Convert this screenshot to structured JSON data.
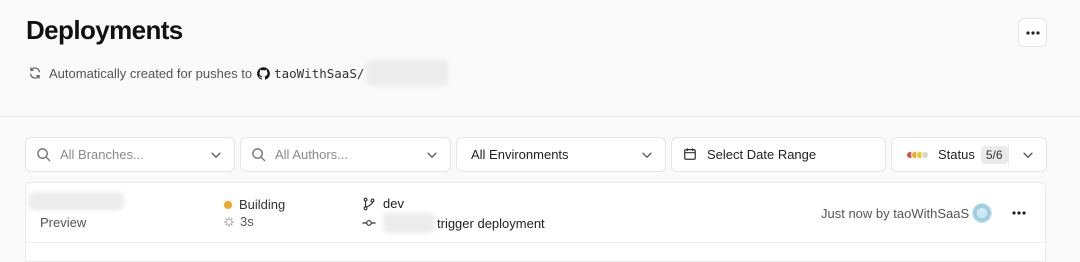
{
  "header": {
    "title": "Deployments",
    "subtitle": "Automatically created for pushes to",
    "repo_owner": "taoWithSaaS/",
    "more_icon": "ellipsis-icon"
  },
  "filters": {
    "branches_placeholder": "All Branches...",
    "authors_placeholder": "All Authors...",
    "environments_value": "All Environments",
    "date_range_label": "Select Date Range",
    "status_label": "Status",
    "status_count": "5/6",
    "status_colors": [
      "#e5484d",
      "#f5a623",
      "#f0c419",
      "#d6d6d6"
    ]
  },
  "deployments": [
    {
      "environment": "Preview",
      "state": "Building",
      "state_color": "#f5a623",
      "duration": "3s",
      "branch": "dev",
      "commit_message": "trigger deployment",
      "meta": "Just now by taoWithSaaS"
    }
  ]
}
